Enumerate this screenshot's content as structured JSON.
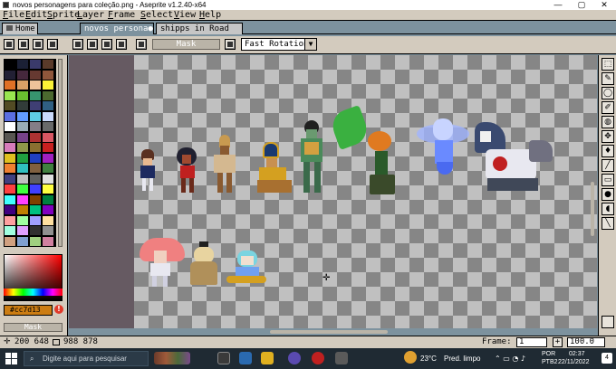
{
  "titlebar": {
    "title": "novos personagens para coleção.png - Aseprite v1.2.40-x64",
    "minimize": "—",
    "maximize": "▢",
    "close": "✕"
  },
  "menu": [
    {
      "label": "File",
      "key": "F",
      "rest": "ile"
    },
    {
      "label": "Edit",
      "key": "E",
      "rest": "dit"
    },
    {
      "label": "Sprite",
      "key": "S",
      "rest": "prite"
    },
    {
      "label": "Layer",
      "key": "L",
      "rest": "ayer"
    },
    {
      "label": "Frame",
      "key": "F",
      "rest": "rame"
    },
    {
      "label": "Select",
      "key": "S",
      "rest": "elect"
    },
    {
      "label": "View",
      "key": "V",
      "rest": "iew"
    },
    {
      "label": "Help",
      "key": "H",
      "rest": "elp"
    }
  ],
  "tabs": [
    {
      "label": "Home"
    },
    {
      "label": "novos persona●"
    },
    {
      "label": "shipps in Road"
    }
  ],
  "toolbar": {
    "mask_label": "Mask",
    "selection_mode": "Fast Rotation",
    "dropdown_arrow": "▼"
  },
  "palette": {
    "colors": [
      "#000000",
      "#1b2035",
      "#3a3a6a",
      "#5a3a2a",
      "#222034",
      "#45283c",
      "#663931",
      "#8f563b",
      "#df7126",
      "#d9a066",
      "#eec39a",
      "#fbf236",
      "#99e550",
      "#6abe30",
      "#37946e",
      "#4b692f",
      "#524b24",
      "#323c39",
      "#3f3f74",
      "#306082",
      "#5b6ee1",
      "#639bff",
      "#5fcde4",
      "#cbdbfc",
      "#ffffff",
      "#9badb7",
      "#847e87",
      "#696a6a",
      "#595652",
      "#76428a",
      "#ac3232",
      "#d95763",
      "#d77bba",
      "#8f974a",
      "#8a6f30",
      "#c82020",
      "#e0c020",
      "#20a040",
      "#2040c0",
      "#a020c0",
      "#f08030",
      "#30c0c0",
      "#806040",
      "#408040",
      "#404080",
      "#c0c0c0",
      "#606060",
      "#e0e0e0",
      "#ff4040",
      "#40ff40",
      "#4040ff",
      "#ffff40",
      "#40ffff",
      "#ff40ff",
      "#804000",
      "#008040",
      "#400080",
      "#c08000",
      "#00c080",
      "#8000c0",
      "#ffa0a0",
      "#a0ffa0",
      "#a0a0ff",
      "#ffe0a0",
      "#a0ffe0",
      "#e0a0ff",
      "#303030",
      "#909090",
      "#d0a080",
      "#80a0d0",
      "#a0d080",
      "#d080a0"
    ]
  },
  "color": {
    "hex": "#cc7d13",
    "warning": "!",
    "mask_label": "Mask",
    "fg": "#cc7d13"
  },
  "status": {
    "position": "200 648",
    "size": "988 878",
    "frame_label": "Frame:",
    "frame_value": "1",
    "zoom_value": "100.0",
    "plus": "+"
  },
  "tools": [
    "⬚",
    "✎",
    "◯",
    "✐",
    "◍",
    "✥",
    "♦",
    "╱",
    "▭",
    "●",
    "◖",
    "╲"
  ],
  "taskbar": {
    "search_placeholder": "Digite aqui para pesquisar",
    "temp": "23°C",
    "weather": "Pred. limpo",
    "lang1": "POR",
    "lang2": "PTB2",
    "time": "02:37",
    "date": "22/11/2022",
    "badge": "4"
  },
  "colors": {
    "ui_bg": "#d3cbbe",
    "canvas_bg": "#7d929e",
    "accent": "#cc7d13"
  }
}
